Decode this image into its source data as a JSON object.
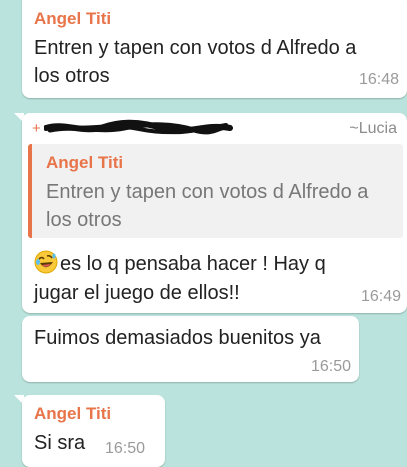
{
  "messages": [
    {
      "sender": "Angel Titi",
      "text_line1": "Entren y tapen con votos d Alfredo a",
      "text_line2": "los otros",
      "time": "16:48"
    },
    {
      "alias": "~Lucia",
      "quote": {
        "sender": "Angel Titi",
        "text_line1": "Entren y tapen con votos d Alfredo a",
        "text_line2": "los otros"
      },
      "text_line1": "es lo q pensaba hacer ! Hay q",
      "text_line2": "jugar el juego de ellos!!",
      "emoji": "rolling-on-floor-laughing-emoji",
      "time": "16:49"
    },
    {
      "text": "Fuimos demasiados buenitos ya",
      "time": "16:50"
    },
    {
      "sender": "Angel Titi",
      "text": "Si sra",
      "time": "16:50"
    }
  ],
  "colors": {
    "background": "#b9e3dc",
    "sender_name": "#e8744a",
    "bubble": "#ffffff"
  }
}
